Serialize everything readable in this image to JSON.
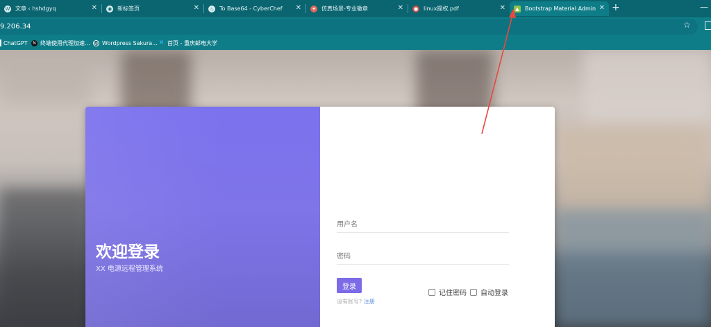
{
  "browser": {
    "tabs": [
      {
        "title": "文章 ‹ hshdgyq",
        "icon": "wordpress-icon"
      },
      {
        "title": "新标签页",
        "icon": "chrome-icon"
      },
      {
        "title": "To Base64 - CyberChef",
        "icon": "cyberchef-icon"
      },
      {
        "title": "仿真场景-专业徽章",
        "icon": "badge-icon"
      },
      {
        "title": "linux提权.pdf",
        "icon": "pdf-icon"
      },
      {
        "title": "Bootstrap Material Admin",
        "icon": "bootstrap-admin-icon"
      }
    ],
    "address": "9.206.34",
    "bookmarks": [
      {
        "label": "ChatGPT",
        "icon": "chatgpt-icon"
      },
      {
        "label": "终端使用代理加速...",
        "icon": "n-icon"
      },
      {
        "label": "Wordpress Sakura...",
        "icon": "wordpress-icon"
      },
      {
        "label": "首页 - 重庆邮电大学",
        "icon": "cqupt-icon"
      }
    ]
  },
  "login": {
    "heading": "欢迎登录",
    "subtitle": "XX 电源远程管理系统",
    "username_placeholder": "用户名",
    "password_placeholder": "密码",
    "login_button": "登录",
    "no_account_text": "没有账号?",
    "register_link": "注册",
    "remember_password": "记住密码",
    "auto_login": "自动登录"
  },
  "colors": {
    "accent": "#7b6be6",
    "annotation_arrow": "#e8483e"
  }
}
